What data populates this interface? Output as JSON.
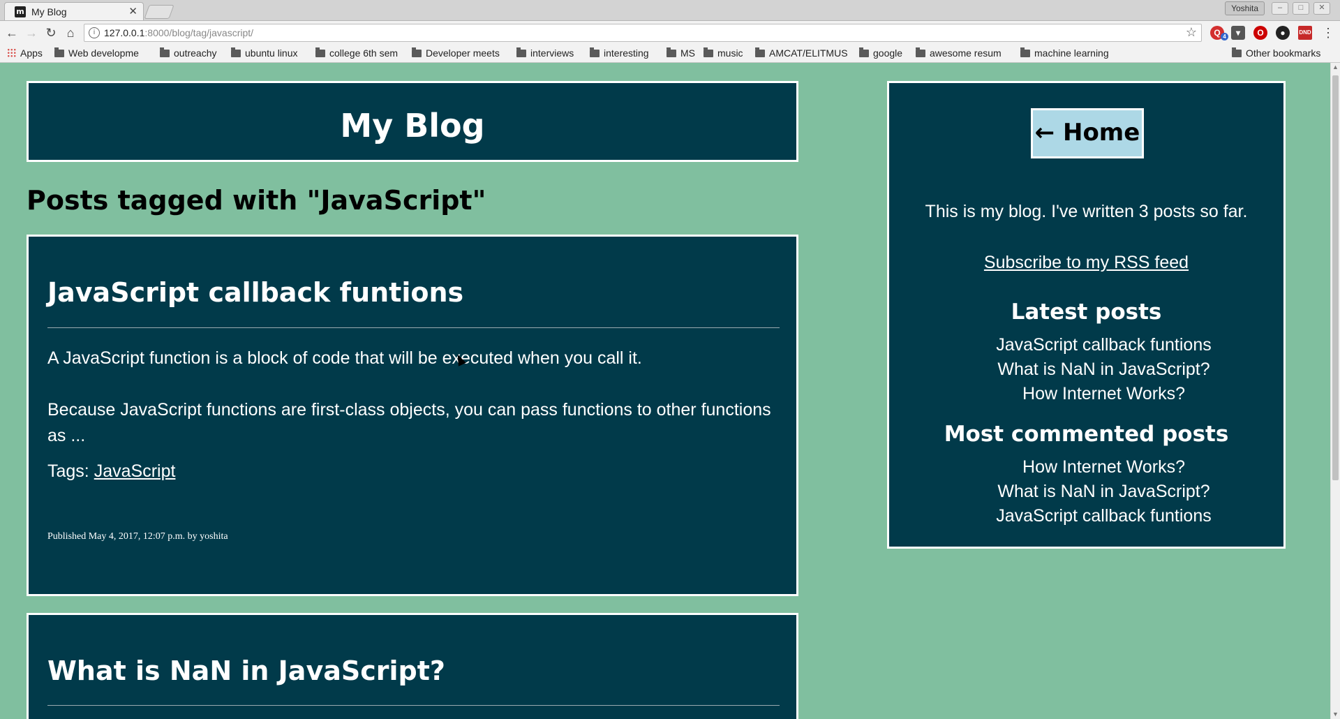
{
  "browser": {
    "tab_title": "My Blog",
    "tab_favicon": "m",
    "tab_close": "✕",
    "user": "Yoshita",
    "url_host": "127.0.0.1",
    "url_path": ":8000/blog/tag/javascript/",
    "ext_badge": "4",
    "ext_dnd": "DND",
    "bookmarks": [
      "Apps",
      "Web developme",
      "outreachy",
      "ubuntu linux",
      "college 6th sem",
      "Developer meets",
      "interviews",
      "interesting",
      "MS",
      "music",
      "AMCAT/ELITMUS",
      "google",
      "awesome resum",
      "machine learning",
      "Other bookmarks"
    ]
  },
  "page": {
    "site_title": "My Blog",
    "tag_heading": "Posts tagged with \"JavaScript\"",
    "posts": [
      {
        "title": "JavaScript callback funtions",
        "paragraphs": [
          "A JavaScript function is a block of code that will be executed when you call it.",
          "Because JavaScript functions are first-class objects, you can pass functions to other functions as ..."
        ],
        "tags_label": "Tags:",
        "tag": "JavaScript",
        "meta": "Published May 4, 2017, 12:07 p.m. by yoshita"
      },
      {
        "title": "What is NaN in JavaScript?"
      }
    ],
    "sidebar": {
      "home_button": "← Home",
      "intro": "This is my blog. I've written 3 posts so far.",
      "rss_link": "Subscribe to my RSS feed",
      "latest_heading": "Latest posts",
      "latest": [
        "JavaScript callback funtions",
        "What is NaN in JavaScript?",
        "How Internet Works?"
      ],
      "most_commented_heading": "Most commented posts",
      "most_commented": [
        "How Internet Works?",
        "What is NaN in JavaScript?",
        "JavaScript callback funtions"
      ]
    }
  },
  "colors": {
    "page_bg": "#80bf9f",
    "box_bg": "#013a4a",
    "home_button_bg": "#add8e6"
  }
}
